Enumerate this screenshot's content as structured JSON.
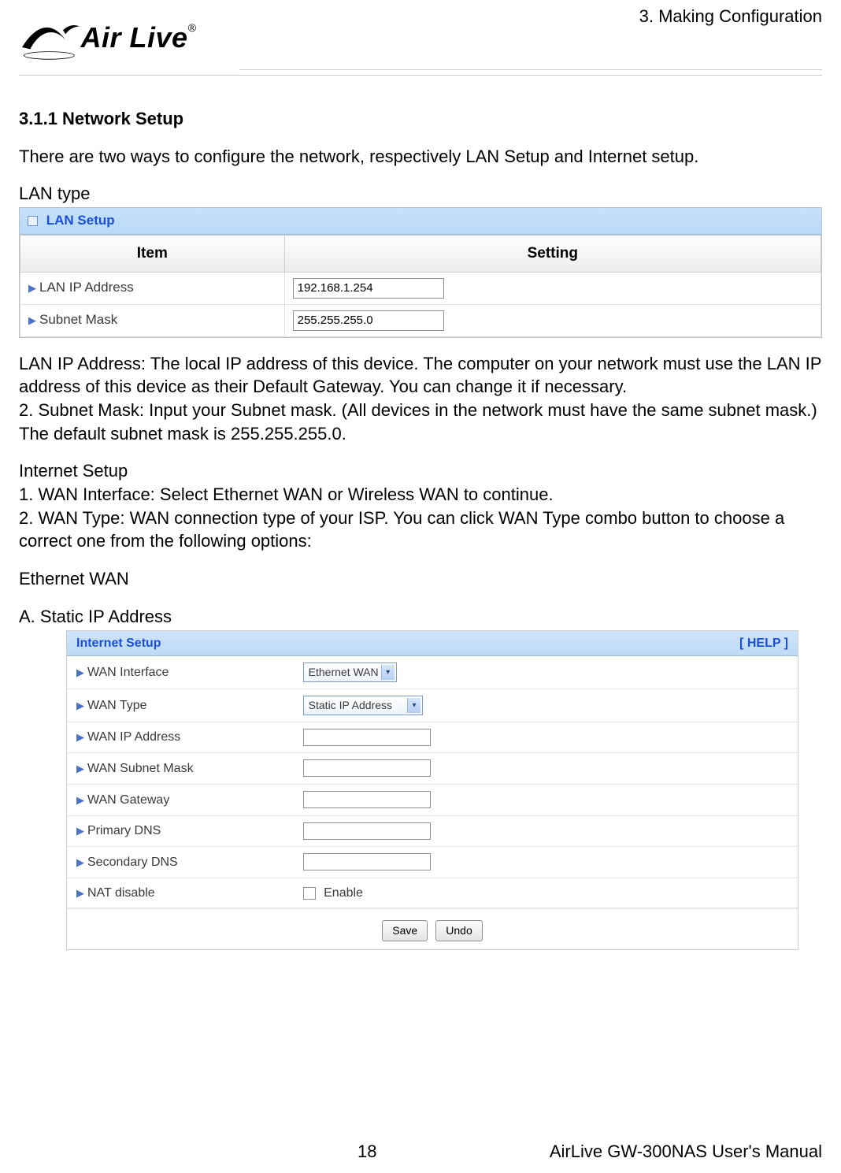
{
  "header": {
    "chapter": "3. Making Configuration",
    "logo_text": "Air Live"
  },
  "section_heading": "3.1.1 Network Setup",
  "intro": "There are two ways to configure the network, respectively LAN Setup and Internet setup.",
  "lan_type_label": "LAN type",
  "lan_panel": {
    "title": "LAN Setup",
    "col_item": "Item",
    "col_setting": "Setting",
    "rows": {
      "ip_label": "LAN IP Address",
      "ip_value": "192.168.1.254",
      "mask_label": "Subnet Mask",
      "mask_value": "255.255.255.0"
    }
  },
  "lan_desc1": "LAN IP Address: The local IP address of this device. The computer on your network   must use the LAN IP address of this device as their Default Gateway. You can change it if necessary.",
  "lan_desc2": "2.   Subnet Mask: Input your Subnet mask. (All devices in the network must have the same subnet mask.) The default subnet mask is 255.255.255.0.",
  "internet_setup_label": "Internet Setup",
  "internet_li1": "  1.   WAN Interface: Select Ethernet WAN or Wireless WAN to continue.",
  "internet_li2": "  2.   WAN Type: WAN connection type of your ISP. You can click WAN Type combo button to choose a correct one from the following options:",
  "ethernet_wan_label": "Ethernet WAN",
  "static_ip_label": "A. Static IP Address",
  "internet_panel": {
    "title": "Internet Setup",
    "help": "[ HELP ]",
    "rows": {
      "wan_if_label": "WAN Interface",
      "wan_if_value": "Ethernet WAN",
      "wan_type_label": "WAN Type",
      "wan_type_value": "Static IP Address",
      "wan_ip_label": "WAN IP Address",
      "wan_mask_label": "WAN Subnet Mask",
      "wan_gw_label": "WAN Gateway",
      "pdns_label": "Primary DNS",
      "sdns_label": "Secondary DNS",
      "nat_label": "NAT disable",
      "nat_enable": "Enable"
    },
    "buttons": {
      "save": "Save",
      "undo": "Undo"
    }
  },
  "footer": {
    "page": "18",
    "doc": "AirLive GW-300NAS User's Manual"
  }
}
